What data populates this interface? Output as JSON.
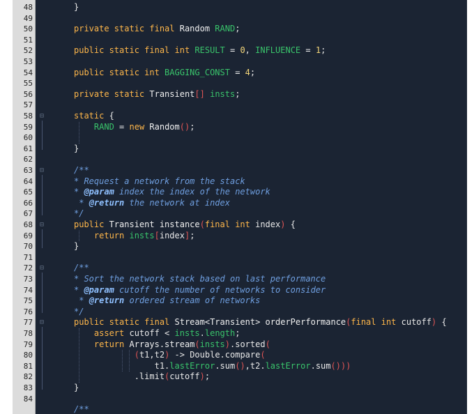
{
  "lines": [
    {
      "n": "48",
      "fold": "",
      "segs": [
        {
          "c": "plain",
          "t": "}"
        }
      ],
      "indent": 1
    },
    {
      "n": "49",
      "fold": "",
      "segs": [],
      "indent": 0
    },
    {
      "n": "50",
      "fold": "",
      "segs": [
        {
          "c": "kw",
          "t": "private static final "
        },
        {
          "c": "type",
          "t": "Random "
        },
        {
          "c": "field",
          "t": "RAND"
        },
        {
          "c": "plain",
          "t": ";"
        }
      ],
      "indent": 1
    },
    {
      "n": "51",
      "fold": "",
      "segs": [],
      "indent": 0
    },
    {
      "n": "52",
      "fold": "",
      "segs": [
        {
          "c": "kw",
          "t": "public static final int "
        },
        {
          "c": "field",
          "t": "RESULT"
        },
        {
          "c": "op",
          "t": " = "
        },
        {
          "c": "num",
          "t": "0"
        },
        {
          "c": "plain",
          "t": ", "
        },
        {
          "c": "field",
          "t": "INFLUENCE"
        },
        {
          "c": "op",
          "t": " = "
        },
        {
          "c": "num",
          "t": "1"
        },
        {
          "c": "plain",
          "t": ";"
        }
      ],
      "indent": 1
    },
    {
      "n": "53",
      "fold": "",
      "segs": [],
      "indent": 0
    },
    {
      "n": "54",
      "fold": "",
      "segs": [
        {
          "c": "kw",
          "t": "public static int "
        },
        {
          "c": "field",
          "t": "BAGGING_CONST"
        },
        {
          "c": "op",
          "t": " = "
        },
        {
          "c": "num",
          "t": "4"
        },
        {
          "c": "plain",
          "t": ";"
        }
      ],
      "indent": 1
    },
    {
      "n": "55",
      "fold": "",
      "segs": [],
      "indent": 0
    },
    {
      "n": "56",
      "fold": "",
      "segs": [
        {
          "c": "kw",
          "t": "private static "
        },
        {
          "c": "type",
          "t": "Transient"
        },
        {
          "c": "paren",
          "t": "[]"
        },
        {
          "c": "plain",
          "t": " "
        },
        {
          "c": "field",
          "t": "insts"
        },
        {
          "c": "plain",
          "t": ";"
        }
      ],
      "indent": 1
    },
    {
      "n": "57",
      "fold": "",
      "segs": [],
      "indent": 0
    },
    {
      "n": "58",
      "fold": "⊟",
      "segs": [
        {
          "c": "kw",
          "t": "static "
        },
        {
          "c": "plain",
          "t": "{"
        }
      ],
      "indent": 1
    },
    {
      "n": "59",
      "fold": "",
      "segs": [
        {
          "c": "plain",
          "t": "    "
        },
        {
          "c": "field",
          "t": "RAND"
        },
        {
          "c": "op",
          "t": " = "
        },
        {
          "c": "kw",
          "t": "new "
        },
        {
          "c": "type",
          "t": "Random"
        },
        {
          "c": "paren",
          "t": "()"
        },
        {
          "c": "plain",
          "t": ";"
        }
      ],
      "indent": 1
    },
    {
      "n": "60",
      "fold": "",
      "segs": [],
      "indent": 0
    },
    {
      "n": "61",
      "fold": "",
      "segs": [
        {
          "c": "plain",
          "t": "}"
        }
      ],
      "indent": 1
    },
    {
      "n": "62",
      "fold": "",
      "segs": [],
      "indent": 0
    },
    {
      "n": "63",
      "fold": "⊟",
      "segs": [
        {
          "c": "cm",
          "t": "/**"
        }
      ],
      "indent": 1
    },
    {
      "n": "64",
      "fold": "",
      "segs": [
        {
          "c": "cm",
          "t": "* Request a network from the stack"
        }
      ],
      "indent": 1
    },
    {
      "n": "65",
      "fold": "",
      "segs": [
        {
          "c": "cm",
          "t": "* "
        },
        {
          "c": "tag",
          "t": "@param"
        },
        {
          "c": "cm",
          "t": " index the index of the network"
        }
      ],
      "indent": 1
    },
    {
      "n": "66",
      "fold": "",
      "segs": [
        {
          "c": "cm",
          "t": " * "
        },
        {
          "c": "tag",
          "t": "@return"
        },
        {
          "c": "cm",
          "t": " the network at index"
        }
      ],
      "indent": 1
    },
    {
      "n": "67",
      "fold": "",
      "segs": [
        {
          "c": "cm",
          "t": "*/"
        }
      ],
      "indent": 1
    },
    {
      "n": "68",
      "fold": "⊟",
      "segs": [
        {
          "c": "kw",
          "t": "public "
        },
        {
          "c": "type",
          "t": "Transient instance"
        },
        {
          "c": "paren",
          "t": "("
        },
        {
          "c": "kw",
          "t": "final int "
        },
        {
          "c": "plain",
          "t": "index"
        },
        {
          "c": "paren",
          "t": ")"
        },
        {
          "c": "plain",
          "t": " {"
        }
      ],
      "indent": 1
    },
    {
      "n": "69",
      "fold": "",
      "segs": [
        {
          "c": "plain",
          "t": "    "
        },
        {
          "c": "kw",
          "t": "return "
        },
        {
          "c": "field",
          "t": "insts"
        },
        {
          "c": "paren",
          "t": "["
        },
        {
          "c": "plain",
          "t": "index"
        },
        {
          "c": "paren",
          "t": "]"
        },
        {
          "c": "plain",
          "t": ";"
        }
      ],
      "indent": 1
    },
    {
      "n": "70",
      "fold": "",
      "segs": [
        {
          "c": "plain",
          "t": "}"
        }
      ],
      "indent": 1
    },
    {
      "n": "71",
      "fold": "",
      "segs": [],
      "indent": 0
    },
    {
      "n": "72",
      "fold": "⊟",
      "segs": [
        {
          "c": "cm",
          "t": "/**"
        }
      ],
      "indent": 1
    },
    {
      "n": "73",
      "fold": "",
      "segs": [
        {
          "c": "cm",
          "t": "* Sort the network stack based on last performance"
        }
      ],
      "indent": 1
    },
    {
      "n": "74",
      "fold": "",
      "segs": [
        {
          "c": "cm",
          "t": "* "
        },
        {
          "c": "tag",
          "t": "@param"
        },
        {
          "c": "cm",
          "t": " cutoff the number of networks to consider"
        }
      ],
      "indent": 1
    },
    {
      "n": "75",
      "fold": "",
      "segs": [
        {
          "c": "cm",
          "t": " * "
        },
        {
          "c": "tag",
          "t": "@return"
        },
        {
          "c": "cm",
          "t": " ordered stream of networks"
        }
      ],
      "indent": 1
    },
    {
      "n": "76",
      "fold": "",
      "segs": [
        {
          "c": "cm",
          "t": "*/"
        }
      ],
      "indent": 1
    },
    {
      "n": "77",
      "fold": "⊟",
      "segs": [
        {
          "c": "kw",
          "t": "public static final "
        },
        {
          "c": "type",
          "t": "Stream<Transient> orderPerformance"
        },
        {
          "c": "paren",
          "t": "("
        },
        {
          "c": "kw",
          "t": "final int "
        },
        {
          "c": "plain",
          "t": "cutoff"
        },
        {
          "c": "paren",
          "t": ")"
        },
        {
          "c": "plain",
          "t": " {"
        }
      ],
      "indent": 1
    },
    {
      "n": "78",
      "fold": "",
      "segs": [
        {
          "c": "plain",
          "t": "    "
        },
        {
          "c": "kw",
          "t": "assert "
        },
        {
          "c": "plain",
          "t": "cutoff < "
        },
        {
          "c": "field",
          "t": "insts"
        },
        {
          "c": "plain",
          "t": "."
        },
        {
          "c": "field",
          "t": "length"
        },
        {
          "c": "plain",
          "t": ";"
        }
      ],
      "indent": 1
    },
    {
      "n": "79",
      "fold": "",
      "segs": [
        {
          "c": "plain",
          "t": "    "
        },
        {
          "c": "kw",
          "t": "return "
        },
        {
          "c": "type",
          "t": "Arrays.stream"
        },
        {
          "c": "paren",
          "t": "("
        },
        {
          "c": "field",
          "t": "insts"
        },
        {
          "c": "paren",
          "t": ")"
        },
        {
          "c": "plain",
          "t": ".sorted"
        },
        {
          "c": "paren",
          "t": "("
        }
      ],
      "indent": 1
    },
    {
      "n": "80",
      "fold": "",
      "segs": [
        {
          "c": "plain",
          "t": "            "
        },
        {
          "c": "paren",
          "t": "("
        },
        {
          "c": "plain",
          "t": "t1,t2"
        },
        {
          "c": "paren",
          "t": ")"
        },
        {
          "c": "plain",
          "t": " -> Double.compare"
        },
        {
          "c": "paren",
          "t": "("
        }
      ],
      "indent": 1
    },
    {
      "n": "81",
      "fold": "",
      "segs": [
        {
          "c": "plain",
          "t": "                t1."
        },
        {
          "c": "field",
          "t": "lastError"
        },
        {
          "c": "plain",
          "t": ".sum"
        },
        {
          "c": "paren",
          "t": "()"
        },
        {
          "c": "plain",
          "t": ",t2."
        },
        {
          "c": "field",
          "t": "lastError"
        },
        {
          "c": "plain",
          "t": ".sum"
        },
        {
          "c": "paren",
          "t": "()))"
        }
      ],
      "indent": 1
    },
    {
      "n": "82",
      "fold": "",
      "segs": [
        {
          "c": "plain",
          "t": "            .limit"
        },
        {
          "c": "paren",
          "t": "("
        },
        {
          "c": "plain",
          "t": "cutoff"
        },
        {
          "c": "paren",
          "t": ")"
        },
        {
          "c": "plain",
          "t": ";"
        }
      ],
      "indent": 1
    },
    {
      "n": "83",
      "fold": "",
      "segs": [
        {
          "c": "plain",
          "t": "}"
        }
      ],
      "indent": 1
    },
    {
      "n": "84",
      "fold": "",
      "segs": [],
      "indent": 0
    },
    {
      "n": "",
      "fold": "",
      "segs": [
        {
          "c": "cm",
          "t": "/**"
        }
      ],
      "indent": 1
    }
  ]
}
